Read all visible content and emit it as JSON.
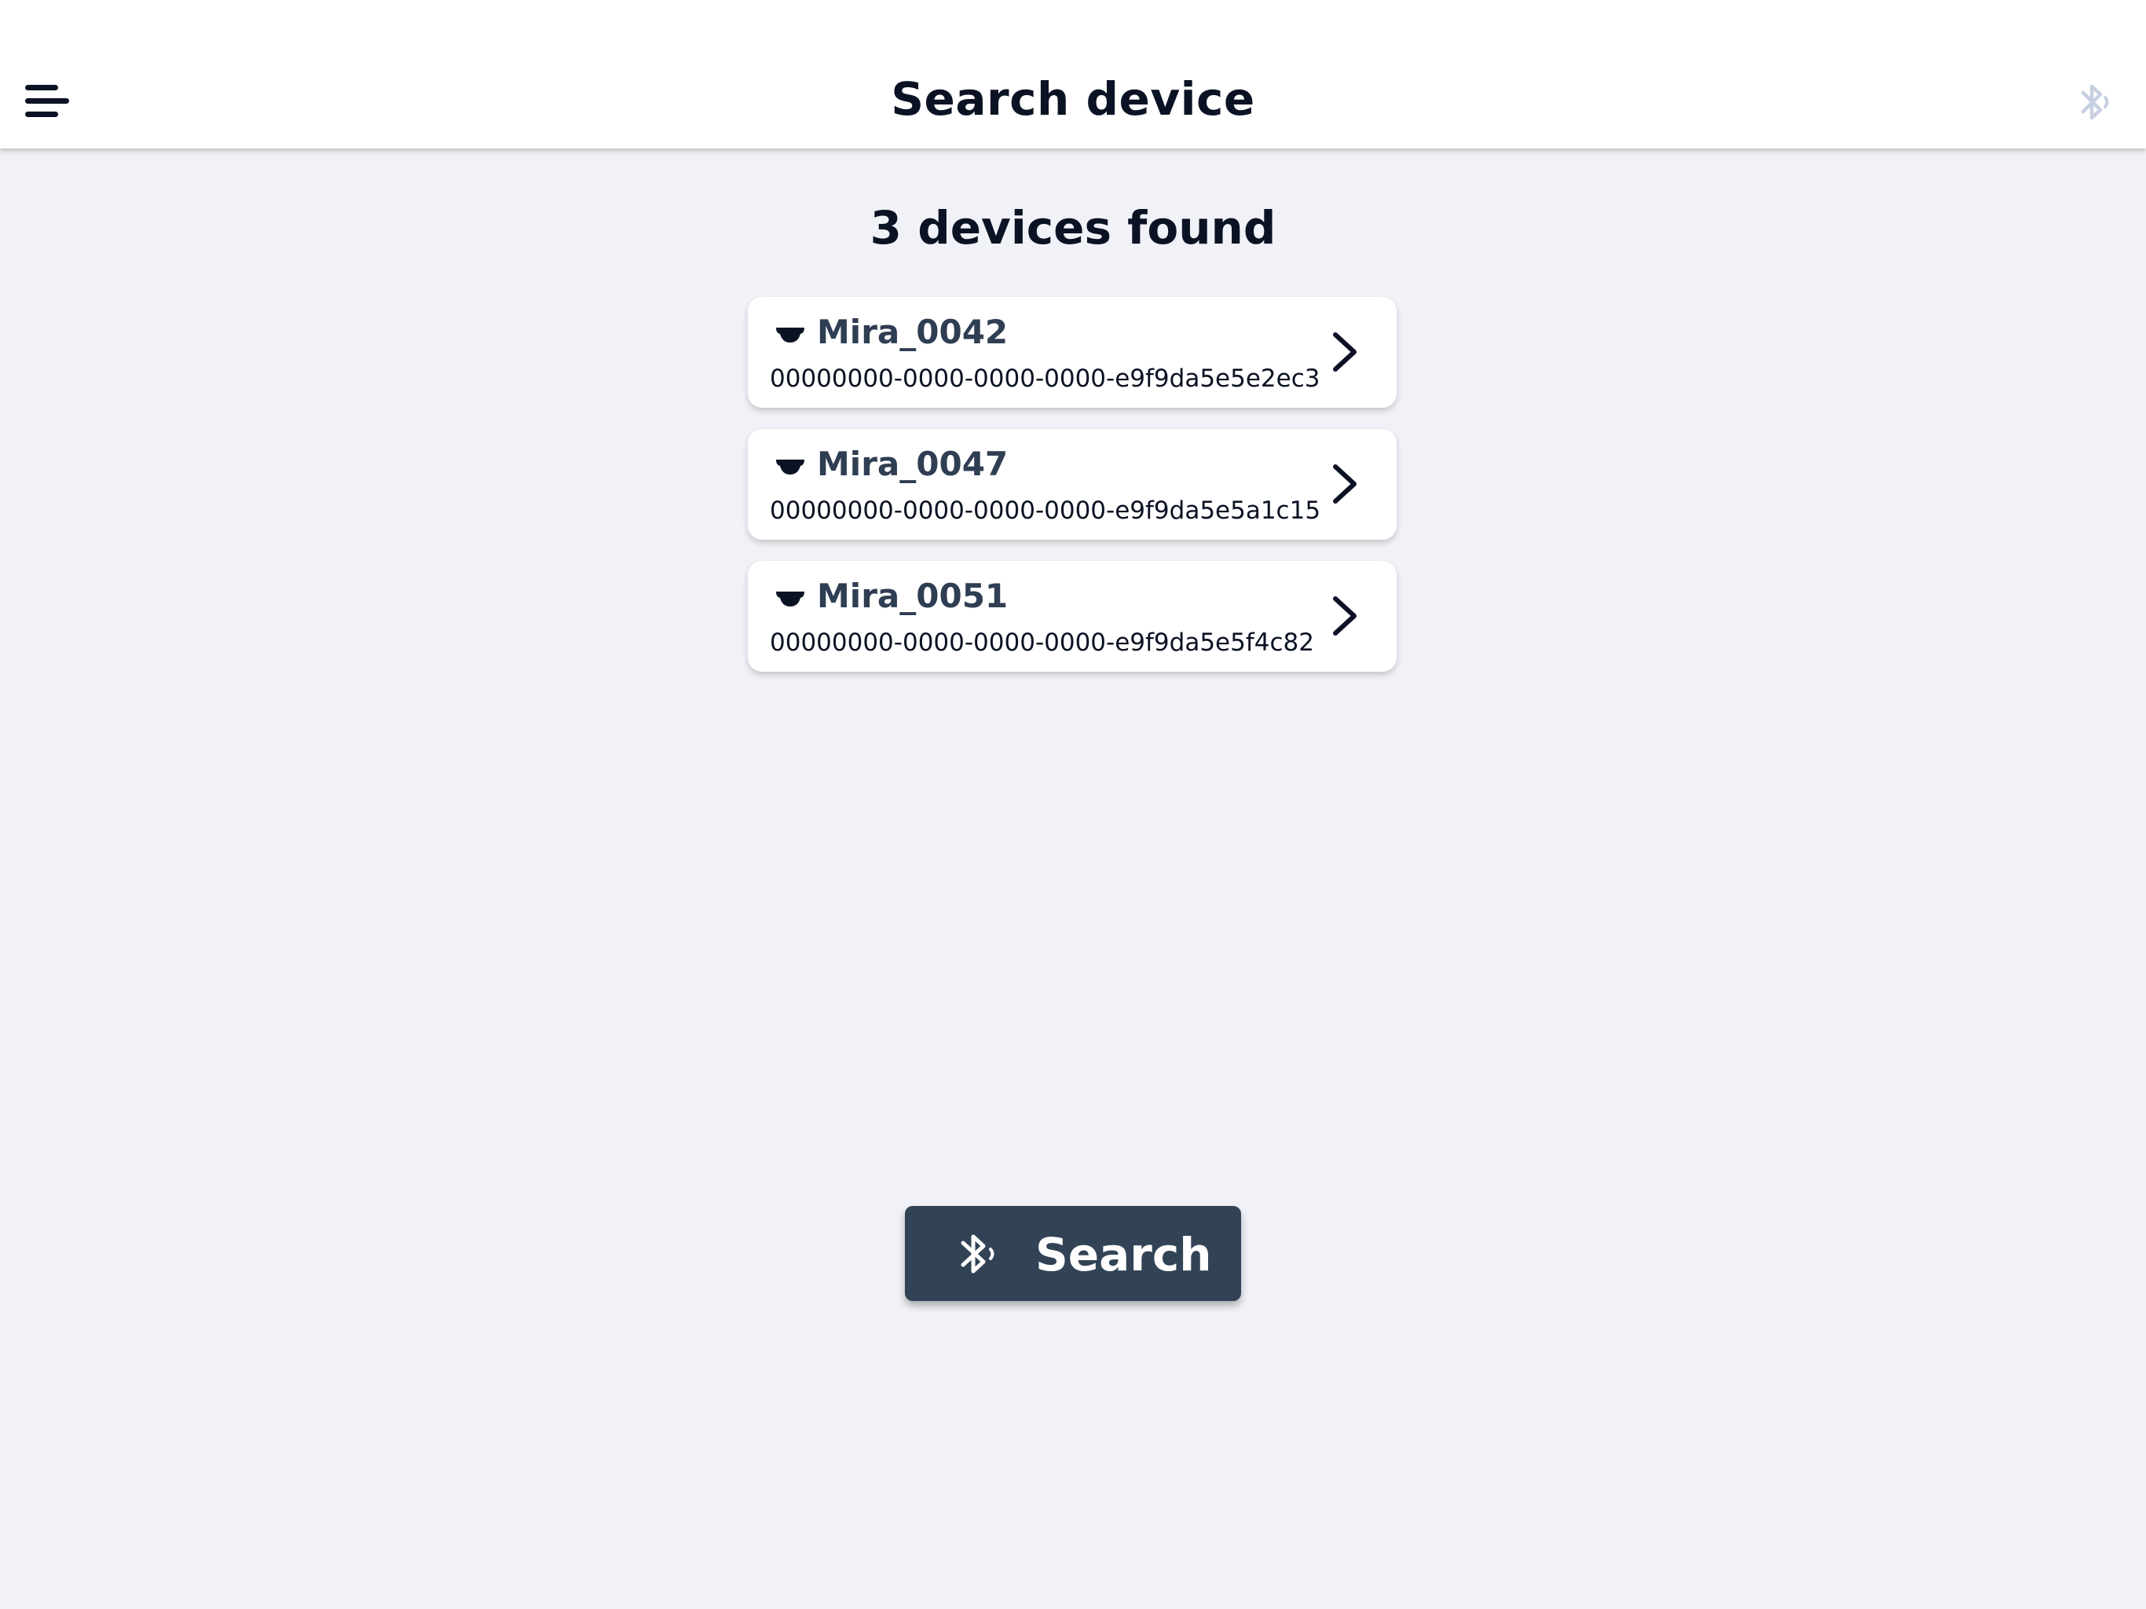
{
  "header": {
    "title": "Search device",
    "menu_icon": "hamburger-menu-icon",
    "status_icon": "bluetooth-searching-icon"
  },
  "main": {
    "count_title": "3 devices found",
    "devices": [
      {
        "name": "Mira_0042",
        "uuid": "00000000-0000-0000-0000-e9f9da5e5e2ec3",
        "icon": "device-icon"
      },
      {
        "name": "Mira_0047",
        "uuid": "00000000-0000-0000-0000-e9f9da5e5a1c15",
        "icon": "device-icon"
      },
      {
        "name": "Mira_0051",
        "uuid": "00000000-0000-0000-0000-e9f9da5e5f4c82",
        "icon": "device-icon"
      }
    ]
  },
  "footer": {
    "search_label": "Search",
    "search_icon": "bluetooth-searching-icon"
  },
  "colors": {
    "background": "#f0f2f7",
    "header": "#ffffff",
    "button": "#324356",
    "text_dark": "#0b1223",
    "device_name": "#2f3e52",
    "bt_status_disabled": "#c7d0e0"
  }
}
